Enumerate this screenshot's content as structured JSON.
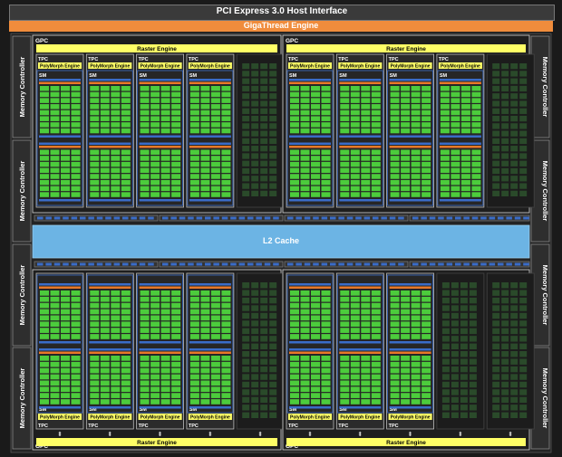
{
  "host_interface": "PCI Express 3.0 Host Interface",
  "gigathread": "GigaThread Engine",
  "l2_cache": "L2 Cache",
  "memory_controller": "Memory Controller",
  "gpc_label": "GPC",
  "raster_engine": "Raster Engine",
  "tpc_label": "TPC",
  "polymorph_engine": "PolyMorph Engine",
  "sm_label": "SM",
  "colors": {
    "background": "#1a1a1a",
    "host_bar": "#3a3a3a",
    "gigathread": "#f08c3c",
    "l2_cache": "#6cb4e4",
    "raster": "#ffff66",
    "core": "#4ccc3c",
    "core_dim": "#2a4a2a",
    "blue": "#3a6cc8",
    "orange": "#e87828",
    "frame": "#d8d8d8"
  },
  "gpcs": [
    {
      "position": "top-left",
      "active_sms": 4
    },
    {
      "position": "top-right",
      "active_sms": 4
    },
    {
      "position": "bottom-left",
      "active_sms": 4
    },
    {
      "position": "bottom-right",
      "active_sms": 3
    }
  ]
}
